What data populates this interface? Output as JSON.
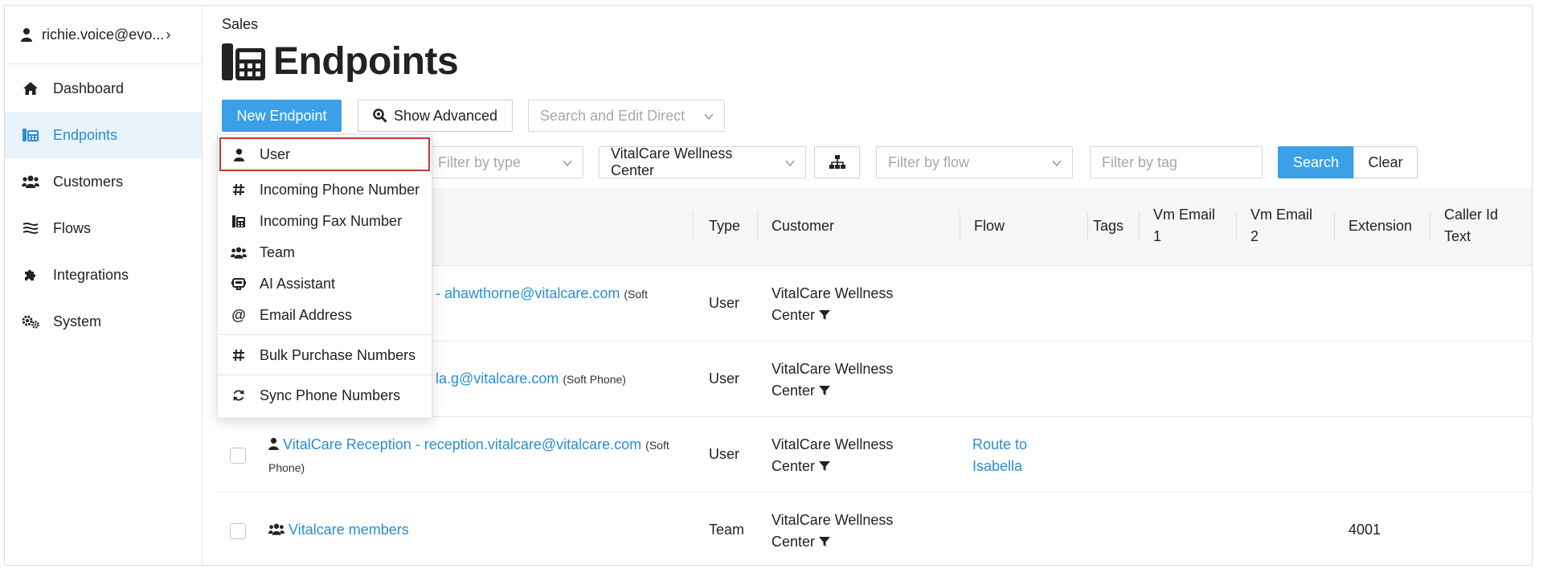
{
  "sidebar": {
    "user": "richie.voice@evo...",
    "items": [
      {
        "label": "Dashboard",
        "icon": "home-icon"
      },
      {
        "label": "Endpoints",
        "icon": "endpoints-icon"
      },
      {
        "label": "Customers",
        "icon": "users-icon"
      },
      {
        "label": "Flows",
        "icon": "flows-icon"
      },
      {
        "label": "Integrations",
        "icon": "puzzle-icon"
      },
      {
        "label": "System",
        "icon": "gears-icon"
      }
    ],
    "active": "Endpoints"
  },
  "header": {
    "breadcrumb": "Sales",
    "title": "Endpoints"
  },
  "toolbar": {
    "new_endpoint": "New Endpoint",
    "show_advanced": "Show Advanced",
    "search_edit_direct": "Search and Edit Direct"
  },
  "filters": {
    "type_placeholder": "Filter by type",
    "customer_selected": "VitalCare Wellness Center",
    "flow_placeholder": "Filter by flow",
    "tag_placeholder": "Filter by tag",
    "search_label": "Search",
    "clear_label": "Clear"
  },
  "dropdown": {
    "items": [
      {
        "label": "User",
        "icon": "user-icon"
      },
      {
        "label": "Incoming Phone Number",
        "icon": "hash-icon"
      },
      {
        "label": "Incoming Fax Number",
        "icon": "fax-icon"
      },
      {
        "label": "Team",
        "icon": "users-icon"
      },
      {
        "label": "AI Assistant",
        "icon": "robot-icon"
      },
      {
        "label": "Email Address",
        "icon": "at-icon"
      },
      {
        "label": "Bulk Purchase Numbers",
        "icon": "hash-icon"
      },
      {
        "label": "Sync Phone Numbers",
        "icon": "sync-icon"
      }
    ]
  },
  "table": {
    "columns": {
      "type": "Type",
      "customer": "Customer",
      "flow": "Flow",
      "tags": "Tags",
      "vm_email_1_a": "Vm Email",
      "vm_email_1_b": "1",
      "vm_email_2_a": "Vm Email",
      "vm_email_2_b": "2",
      "extension": "Extension",
      "caller_id_a": "Caller Id",
      "caller_id_b": "Text"
    },
    "rows": [
      {
        "name": "- ahawthorne@vitalcare.com",
        "suffix": "(Soft",
        "type": "User",
        "customer_a": "VitalCare Wellness",
        "customer_b": "Center",
        "flow_a": "",
        "flow_b": "",
        "extension": ""
      },
      {
        "name": "la.g@vitalcare.com",
        "suffix": "(Soft Phone)",
        "type": "User",
        "customer_a": "VitalCare Wellness",
        "customer_b": "Center",
        "flow_a": "",
        "flow_b": "",
        "extension": ""
      },
      {
        "name": "VitalCare Reception - reception.vitalcare@vitalcare.com",
        "suffix": "(Soft",
        "suffix2": "Phone)",
        "type": "User",
        "customer_a": "VitalCare Wellness",
        "customer_b": "Center",
        "flow_a": "Route to",
        "flow_b": "Isabella",
        "extension": ""
      },
      {
        "name": "Vitalcare members",
        "type": "Team",
        "customer_a": "VitalCare Wellness",
        "customer_b": "Center",
        "flow_a": "",
        "flow_b": "",
        "extension": "4001"
      }
    ]
  },
  "colors": {
    "accent": "#3aa0e8",
    "link": "#2a8dd4",
    "active_bg": "#e8f3fb",
    "highlight_border": "#c0392b"
  }
}
